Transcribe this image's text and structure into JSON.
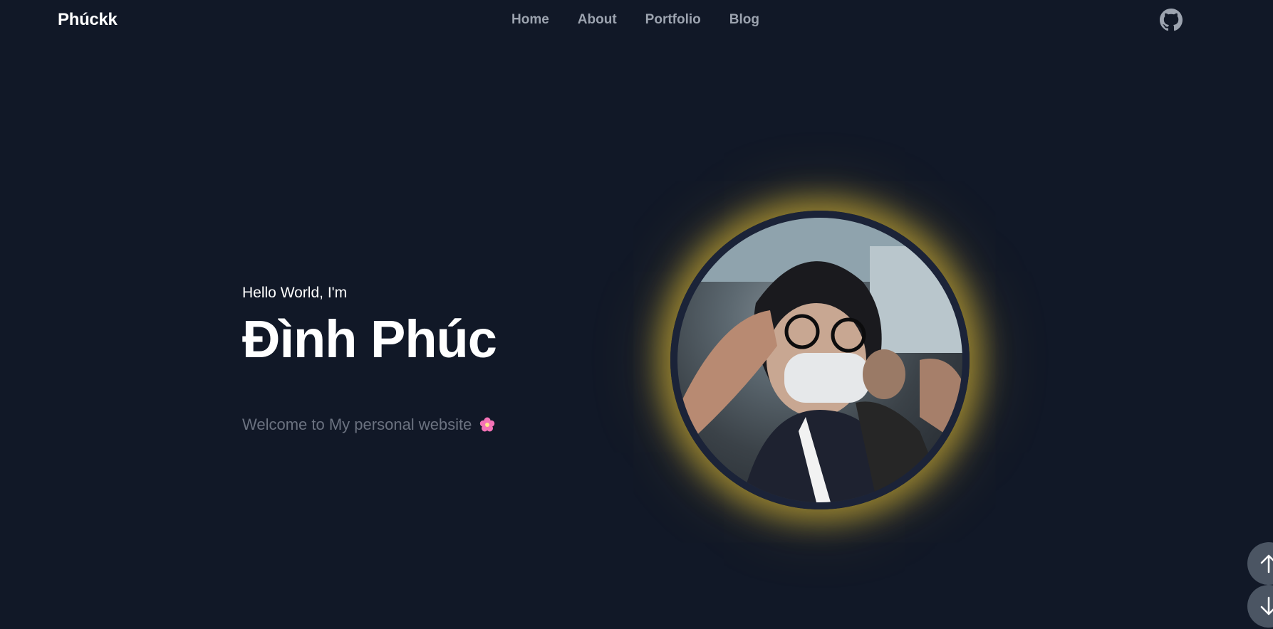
{
  "nav": {
    "logo": "Phúckk",
    "links": [
      "Home",
      "About",
      "Portfolio",
      "Blog"
    ],
    "github_icon": "github-icon"
  },
  "hero": {
    "greeting": "Hello World, I'm",
    "name": "Đình Phúc",
    "welcome": "Welcome to My personal website",
    "welcome_icon": "cherry-blossom-icon"
  },
  "avatar": {
    "glow_color": "#eac435",
    "border_color": "#1b2338"
  },
  "scroll": {
    "up_icon": "arrow-up-icon",
    "down_icon": "arrow-down-icon"
  },
  "colors": {
    "background": "#111827",
    "nav_link": "#9ca3af",
    "muted_text": "#6b7280",
    "scroll_button": "#4b5563"
  }
}
